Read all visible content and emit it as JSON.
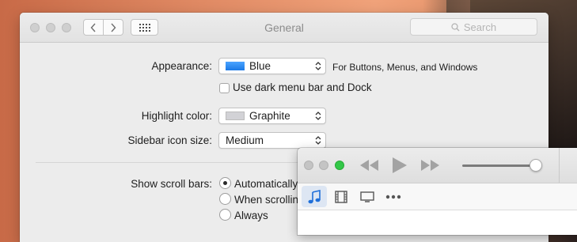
{
  "prefs_window": {
    "title": "General",
    "search_placeholder": "Search",
    "appearance": {
      "label": "Appearance:",
      "value": "Blue",
      "swatch_color": "#1b79e6",
      "note": "For Buttons, Menus, and Windows"
    },
    "dark_menu": {
      "label": "Use dark menu bar and Dock",
      "checked": false
    },
    "highlight": {
      "label": "Highlight color:",
      "value": "Graphite",
      "swatch_color": "#cfcfd2"
    },
    "sidebar_icon_size": {
      "label": "Sidebar icon size:",
      "value": "Medium"
    },
    "scroll_bars": {
      "label": "Show scroll bars:",
      "options": [
        "Automatically",
        "When scrolling",
        "Always"
      ],
      "selected": "Automatically"
    }
  },
  "itunes_window": {
    "volume_level": 0.95,
    "media_tabs": [
      "music",
      "movies",
      "tv-shows",
      "more"
    ],
    "active_tab": "music",
    "active_tab_color": "#1f6fd9"
  }
}
